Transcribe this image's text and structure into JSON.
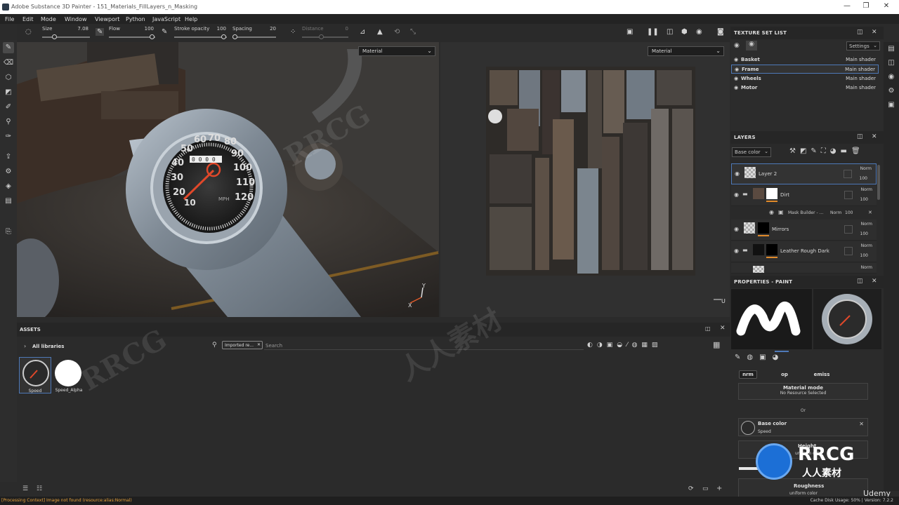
{
  "window": {
    "title": "Adobe Substance 3D Painter - 151_Materials_FillLayers_n_Masking",
    "minimize": "—",
    "maximize": "❐",
    "close": "✕"
  },
  "menu": [
    "File",
    "Edit",
    "Mode",
    "Window",
    "Viewport",
    "Python",
    "JavaScript",
    "Help"
  ],
  "tool_options": {
    "size_label": "Size",
    "size_value": "7.08",
    "flow_label": "Flow",
    "flow_value": "100",
    "stroke_opacity_label": "Stroke opacity",
    "stroke_opacity_value": "100",
    "spacing_label": "Spacing",
    "spacing_value": "20",
    "distance_label": "Distance",
    "distance_value": "0"
  },
  "viewport3d": {
    "mode_select": "Material"
  },
  "viewport2d": {
    "mode_select": "Material"
  },
  "gauge": {
    "labels": [
      "10",
      "20",
      "30",
      "40",
      "50",
      "60",
      "70",
      "80",
      "90",
      "100",
      "110",
      "120"
    ],
    "odometer": "0 0 0 0",
    "unit": "MPH"
  },
  "texture_set_list": {
    "title": "TEXTURE SET LIST",
    "settings_label": "Settings",
    "items": [
      {
        "name": "Basket",
        "shader": "Main shader"
      },
      {
        "name": "Frame",
        "shader": "Main shader"
      },
      {
        "name": "Wheels",
        "shader": "Main shader"
      },
      {
        "name": "Motor",
        "shader": "Main shader"
      }
    ],
    "selected_index": 1
  },
  "layers": {
    "title": "LAYERS",
    "channel_select": "Base color",
    "items": [
      {
        "name": "Layer 2",
        "blend": "Norm",
        "opacity": "100"
      },
      {
        "name": "Dirt",
        "blend": "Norm",
        "opacity": "100"
      },
      {
        "name": "Mask Builder - ...",
        "blend": "Norm",
        "opacity": "100"
      },
      {
        "name": "Mirrors",
        "blend": "Norm",
        "opacity": "100"
      },
      {
        "name": "Leather Rough Dark",
        "blend": "Norm",
        "opacity": "100"
      },
      {
        "name": "",
        "blend": "Norm",
        "opacity": ""
      }
    ]
  },
  "properties": {
    "title": "PROPERTIES - PAINT",
    "channel_buttons": [
      "nrm",
      "op",
      "emiss"
    ],
    "material_mode_label": "Material mode",
    "material_mode_value": "No Resource Selected",
    "or_label": "Or",
    "base_color_label": "Base color",
    "base_color_value": "Speed",
    "height_label": "Height",
    "height_value": "uniform color",
    "roughness_label": "Roughness",
    "roughness_value": "uniform color"
  },
  "assets": {
    "title": "ASSETS",
    "tree_root": "All libraries",
    "filter_chip": "Imported re...",
    "search_placeholder": "Search",
    "items": [
      {
        "name": "Speed"
      },
      {
        "name": "Speed_Alpha"
      }
    ]
  },
  "status": {
    "error": "[Processing Context] Image not found (resource:alias:Normal)",
    "cache": "Cache Disk Usage:   50%  |  Version: 7.2.2"
  },
  "watermarks": {
    "rrcg": "RRCG",
    "cn": "人人素材",
    "udemy": "Udemy"
  },
  "colors": {
    "accent": "#4e79b8",
    "orange": "#e08a2a",
    "needle": "#e0482a"
  }
}
